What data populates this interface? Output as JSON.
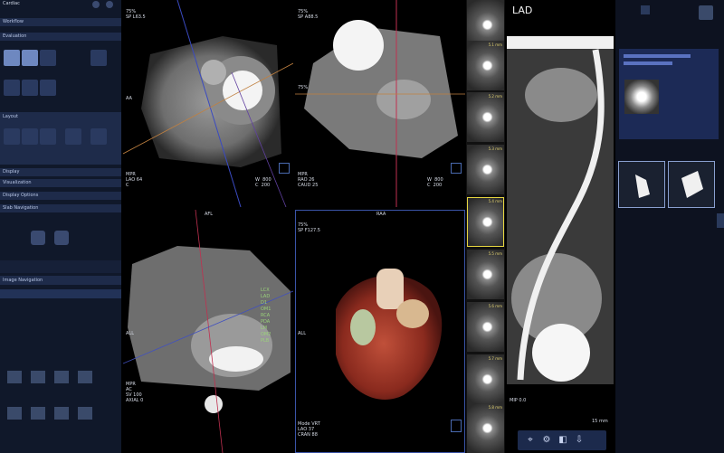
{
  "sidebar": {
    "title": "Cardiac",
    "sections": [
      "Workflow",
      "Evaluation",
      "Layout",
      "Display",
      "Visualization",
      "Display Options",
      "Slab Navigation"
    ],
    "bottom_label": "Image Navigation"
  },
  "viewports": {
    "short_axis": {
      "top_left": "75%\nSP L63.5",
      "left": "AA",
      "bottom_left": "MPR\nLAO 64\nC",
      "bottom_right": "W  800\nC  200"
    },
    "long_axis": {
      "top_left": "75%\nSP A88.5",
      "left": "75%",
      "bottom_left": "MPR\nRAO 26\nCAUD 25",
      "bottom_right": "W  800\nC  200"
    },
    "axial": {
      "top": "AFL",
      "left": "ALL",
      "bottom_left": "MPR\nAC\nSV 100\nAXIAL 0",
      "labels": [
        "LCX",
        "LAD",
        "D1",
        "OM1",
        "RCA",
        "PDA",
        "LM",
        "OM2",
        "PLB"
      ]
    },
    "vrt": {
      "top": "RAA",
      "top_left": "75%\nSP F127.5",
      "left": "ALL",
      "bottom_left": "Mode VRT\nLAO 37\nCRAN 88"
    },
    "cpr": {
      "title": "LAD",
      "bottom_left": "MIP 0.0",
      "bottom_right": "15 mm"
    }
  },
  "strip": {
    "labels": [
      "5.1 mm",
      "5.2 mm",
      "5.3 mm",
      "5.4 mm",
      "5.5 mm",
      "5.6 mm",
      "5.7 mm",
      "5.8 mm",
      "5.9 mm"
    ]
  },
  "colors": {
    "accent": "#3a54a8",
    "selection": "#e6d640",
    "panel": "#10182a"
  }
}
